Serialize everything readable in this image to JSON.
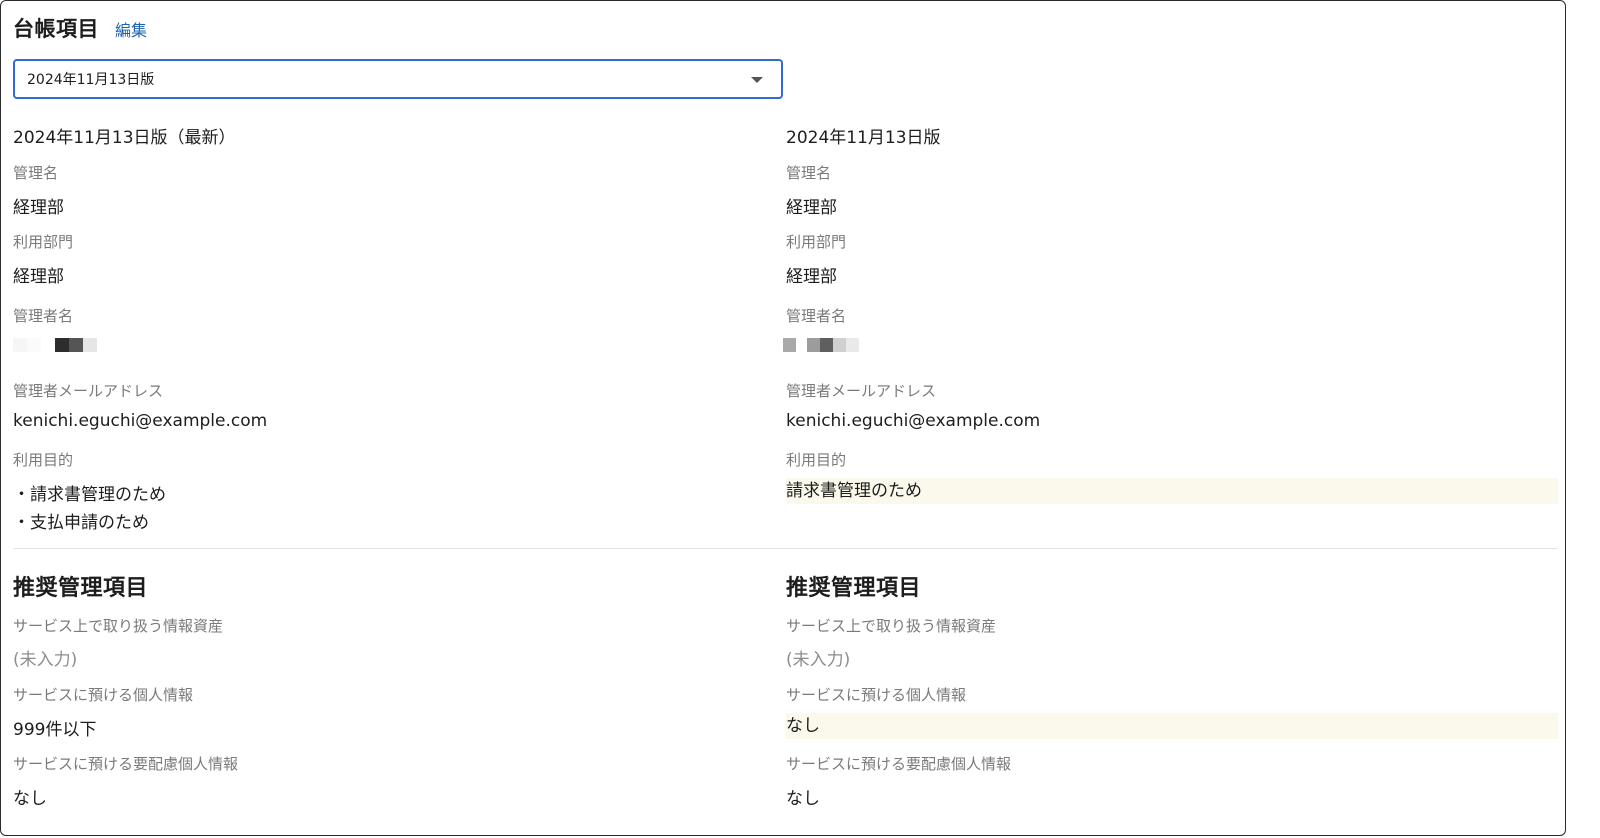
{
  "header": {
    "title": "台帳項目",
    "edit_label": "編集"
  },
  "version_select": {
    "value": "2024年11月13日版"
  },
  "left": {
    "version_title": "2024年11月13日版（最新）",
    "management_name_label": "管理名",
    "management_name": "経理部",
    "department_label": "利用部門",
    "department": "経理部",
    "manager_name_label": "管理者名",
    "manager_email_label": "管理者メールアドレス",
    "manager_email": "kenichi.eguchi@example.com",
    "purpose_label": "利用目的",
    "purposes": [
      "・請求書管理のため",
      "・支払申請のため"
    ],
    "recommended_title": "推奨管理項目",
    "info_assets_label": "サービス上で取り扱う情報資産",
    "info_assets": "(未入力)",
    "personal_info_label": "サービスに預ける個人情報",
    "personal_info": "999件以下",
    "sensitive_info_label": "サービスに預ける要配慮個人情報",
    "sensitive_info": "なし"
  },
  "right": {
    "version_title": "2024年11月13日版",
    "management_name_label": "管理名",
    "management_name": "経理部",
    "department_label": "利用部門",
    "department": "経理部",
    "manager_name_label": "管理者名",
    "manager_email_label": "管理者メールアドレス",
    "manager_email": "kenichi.eguchi@example.com",
    "purpose_label": "利用目的",
    "purpose": "請求書管理のため",
    "recommended_title": "推奨管理項目",
    "info_assets_label": "サービス上で取り扱う情報資産",
    "info_assets": "(未入力)",
    "personal_info_label": "サービスに預ける個人情報",
    "personal_info": "なし",
    "sensitive_info_label": "サービスに預ける要配慮個人情報",
    "sensitive_info": "なし"
  },
  "colors": {
    "accent": "#2f6bd6",
    "link": "#1b63b3",
    "diff_highlight": "#fbf9eb"
  }
}
